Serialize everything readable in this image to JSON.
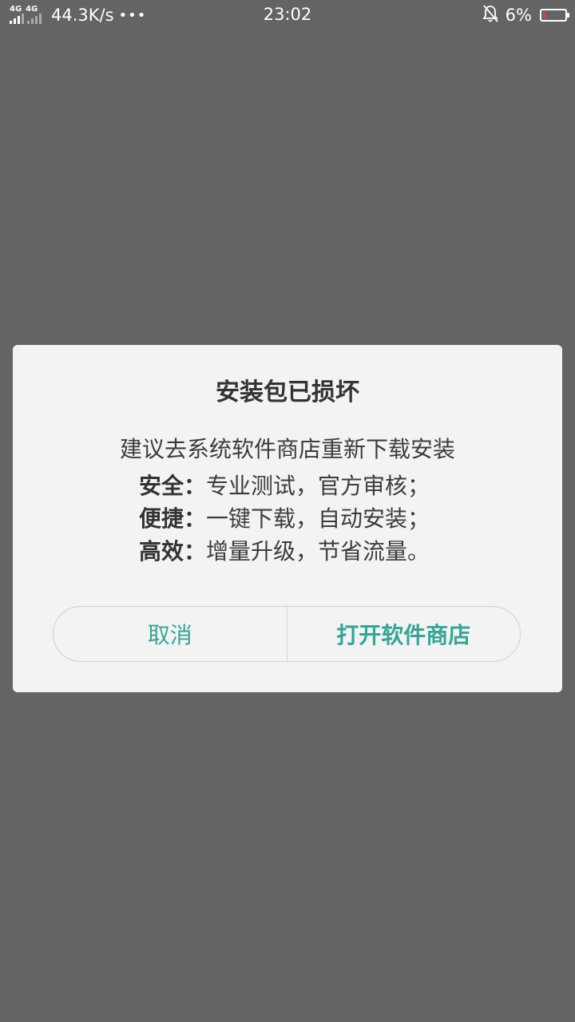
{
  "status_bar": {
    "network_1": "4G",
    "network_2": "4G",
    "net_speed": "44.3K/s",
    "more_indicator": "•••",
    "time": "23:02",
    "battery_percent": "6%",
    "battery_level": 0.06,
    "icons": [
      "signal-icon",
      "mute-bell-icon",
      "battery-icon"
    ]
  },
  "dialog": {
    "title": "安装包已损坏",
    "subtitle": "建议去系统软件商店重新下载安装",
    "features": [
      {
        "key": "安全：",
        "value": "专业测试，官方审核；"
      },
      {
        "key": "便捷：",
        "value": "一键下载，自动安装；"
      },
      {
        "key": "高效：",
        "value": "增量升级，节省流量。"
      }
    ],
    "cancel_label": "取消",
    "confirm_label": "打开软件商店"
  },
  "colors": {
    "overlay": "#646464",
    "dialog_bg": "#f3f3f3",
    "accent": "#35a596",
    "battery_low": "#ff3030"
  }
}
